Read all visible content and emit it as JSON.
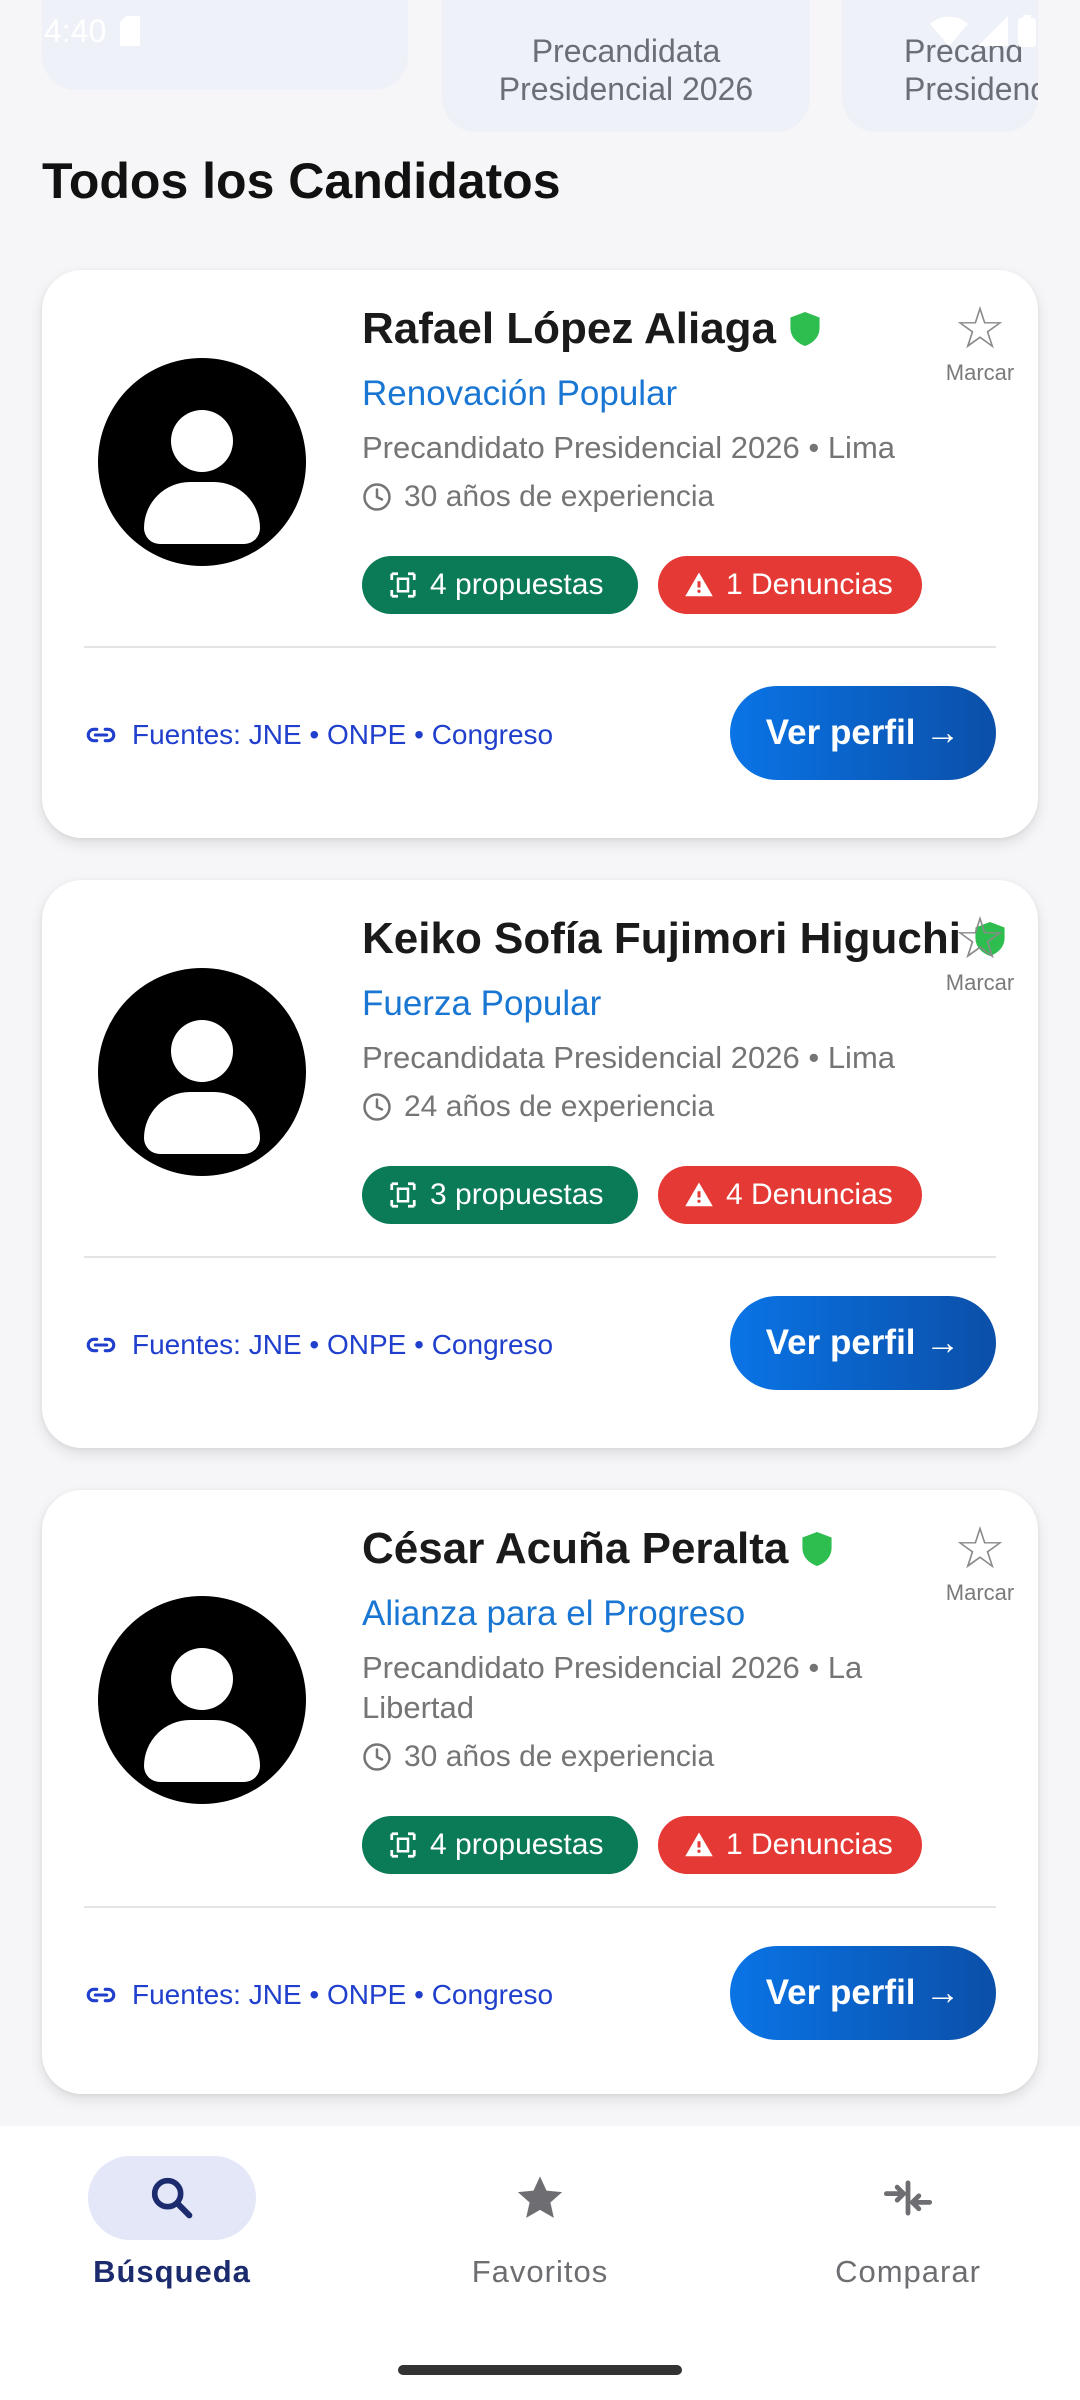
{
  "status_bar": {
    "time": "4:40"
  },
  "chips": [
    {
      "line1": "",
      "line2": ""
    },
    {
      "line1": "Precandidata",
      "line2": "Presidencial 2026"
    },
    {
      "line1": "Precand",
      "line2": "Presidenc"
    }
  ],
  "section_title": "Todos los Candidatos",
  "candidates": [
    {
      "name": "Rafael López Aliaga",
      "party": "Renovación Popular",
      "role": "Precandidato Presidencial 2026 • Lima",
      "experience": "30 años de experiencia",
      "proposals": "4 propuestas",
      "complaints": "1 Denuncias",
      "sources": "Fuentes: JNE • ONPE • Congreso",
      "button": "Ver perfil →",
      "bookmark": "Marcar"
    },
    {
      "name": "Keiko Sofía Fujimori Higuchi",
      "party": "Fuerza Popular",
      "role": "Precandidata Presidencial 2026 • Lima",
      "experience": "24 años de experiencia",
      "proposals": "3 propuestas",
      "complaints": "4 Denuncias",
      "sources": "Fuentes: JNE • ONPE • Congreso",
      "button": "Ver perfil →",
      "bookmark": "Marcar"
    },
    {
      "name": "César Acuña Peralta",
      "party": "Alianza para el Progreso",
      "role": "Precandidato Presidencial 2026 • La Libertad",
      "experience": "30 años de experiencia",
      "proposals": "4 propuestas",
      "complaints": "1 Denuncias",
      "sources": "Fuentes: JNE • ONPE • Congreso",
      "button": "Ver perfil →",
      "bookmark": "Marcar"
    }
  ],
  "bottom_nav": [
    {
      "label": "Búsqueda",
      "icon": "search-icon",
      "active": true
    },
    {
      "label": "Favoritos",
      "icon": "star-icon",
      "active": false
    },
    {
      "label": "Comparar",
      "icon": "compare-icon",
      "active": false
    }
  ],
  "colors": {
    "accent": "#1976d2",
    "proposals_badge": "#0b7a56",
    "complaints_badge": "#e53935",
    "verified": "#2ebd4f",
    "nav_active": "#1c2b6e"
  }
}
